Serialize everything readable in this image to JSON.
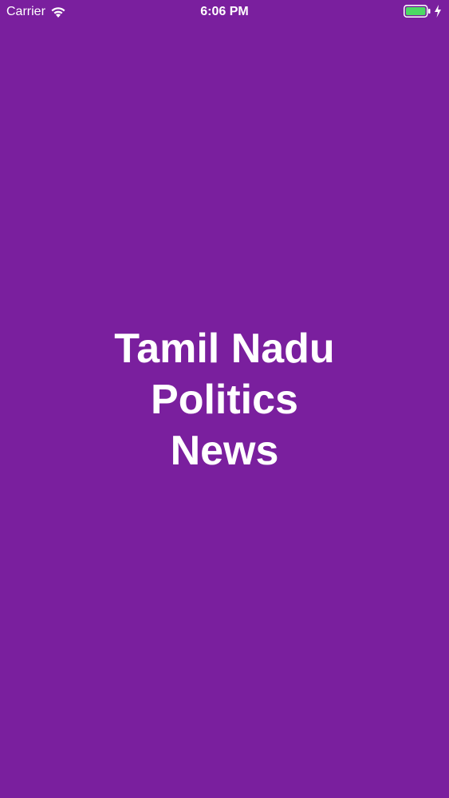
{
  "status_bar": {
    "carrier": "Carrier",
    "time": "6:06 PM",
    "icons": [
      "wifi-icon",
      "battery-icon",
      "charging-bolt-icon"
    ],
    "battery_color": "#4cd964"
  },
  "splash": {
    "title_lines": [
      "Tamil Nadu",
      "Politics",
      "News"
    ],
    "background_color": "#7a1f9e",
    "text_color": "#ffffff"
  }
}
